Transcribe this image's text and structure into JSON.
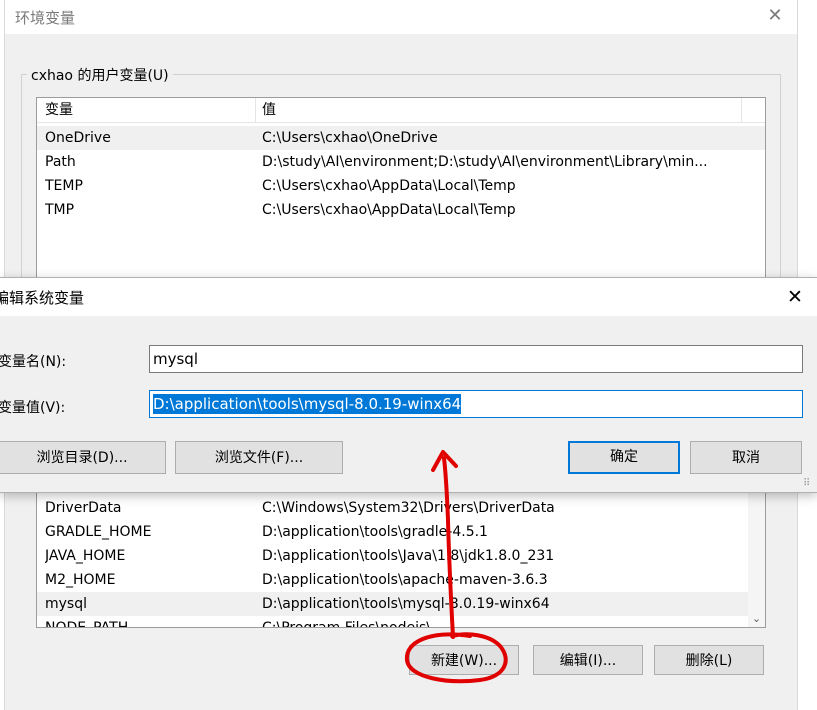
{
  "env_window": {
    "title": "环境变量",
    "close_glyph": "✕"
  },
  "user_vars": {
    "group_label": "cxhao 的用户变量(U)",
    "headers": {
      "name": "变量",
      "value": "值"
    },
    "rows": [
      {
        "name": "OneDrive",
        "value": "C:\\Users\\cxhao\\OneDrive"
      },
      {
        "name": "Path",
        "value": "D:\\study\\AI\\environment;D:\\study\\AI\\environment\\Library\\min..."
      },
      {
        "name": "TEMP",
        "value": "C:\\Users\\cxhao\\AppData\\Local\\Temp"
      },
      {
        "name": "TMP",
        "value": "C:\\Users\\cxhao\\AppData\\Local\\Temp"
      }
    ]
  },
  "system_vars": {
    "rows": [
      {
        "name": "DriverData",
        "value": "C:\\Windows\\System32\\Drivers\\DriverData"
      },
      {
        "name": "GRADLE_HOME",
        "value": "D:\\application\\tools\\gradle-4.5.1"
      },
      {
        "name": "JAVA_HOME",
        "value": "D:\\application\\tools\\Java\\1.8\\jdk1.8.0_231"
      },
      {
        "name": "M2_HOME",
        "value": "D:\\application\\tools\\apache-maven-3.6.3"
      },
      {
        "name": "mysql",
        "value": "D:\\application\\tools\\mysql-8.0.19-winx64",
        "selected": true
      },
      {
        "name": "NODE_PATH",
        "value": "C:\\Program Files\\nodejs\\"
      }
    ],
    "buttons": {
      "new": "新建(W)...",
      "edit": "编辑(I)...",
      "delete": "删除(L)"
    }
  },
  "edit_dialog": {
    "title": "编辑系统变量",
    "close_glyph": "✕",
    "name_label": "变量名(N):",
    "name_value": "mysql",
    "value_label": "变量值(V):",
    "value_value": "D:\\application\\tools\\mysql-8.0.19-winx64",
    "browse_dir": "浏览目录(D)...",
    "browse_file": "浏览文件(F)...",
    "ok": "确定",
    "cancel": "取消"
  },
  "colors": {
    "accent": "#0078d7",
    "annotation": "#e00000"
  }
}
